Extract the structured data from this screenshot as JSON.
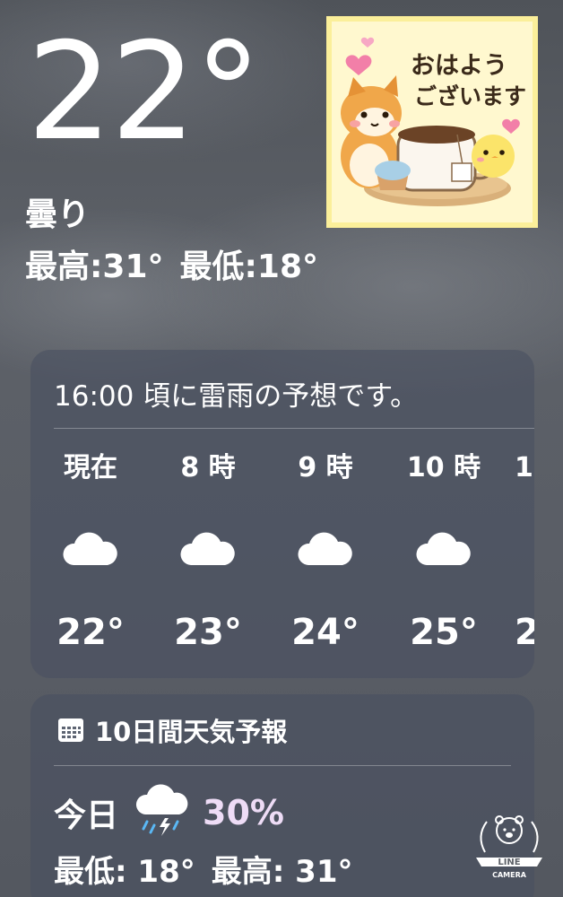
{
  "current": {
    "temperature": "22°",
    "condition": "曇り",
    "high": "最高:31°",
    "low": "最低:18°"
  },
  "sticker": {
    "text_line1": "おはよう",
    "text_line2": "ございます"
  },
  "hourly": {
    "alert": "16:00 頃に雷雨の予想です。",
    "items": [
      {
        "label": "現在",
        "icon": "cloud-icon",
        "temp": "22°"
      },
      {
        "label": "8 時",
        "icon": "cloud-icon",
        "temp": "23°"
      },
      {
        "label": "9 時",
        "icon": "cloud-icon",
        "temp": "24°"
      },
      {
        "label": "10 時",
        "icon": "cloud-icon",
        "temp": "25°"
      },
      {
        "label": "1",
        "icon": "cloud-icon",
        "temp": "2"
      }
    ]
  },
  "forecast": {
    "title": "10日間天気予報",
    "header_icon": "calendar-icon",
    "today": {
      "label": "今日",
      "icon": "thunderstorm-rain-icon",
      "precip": "30%",
      "low": "最低: 18°",
      "high": "最高: 31°"
    }
  },
  "watermark": {
    "brand_line1": "LINE",
    "brand_line2": "CAMERA"
  },
  "colors": {
    "precip": "#eedcf6",
    "sticker_border": "#fbef9a",
    "sticker_bg": "#fff8cf"
  }
}
